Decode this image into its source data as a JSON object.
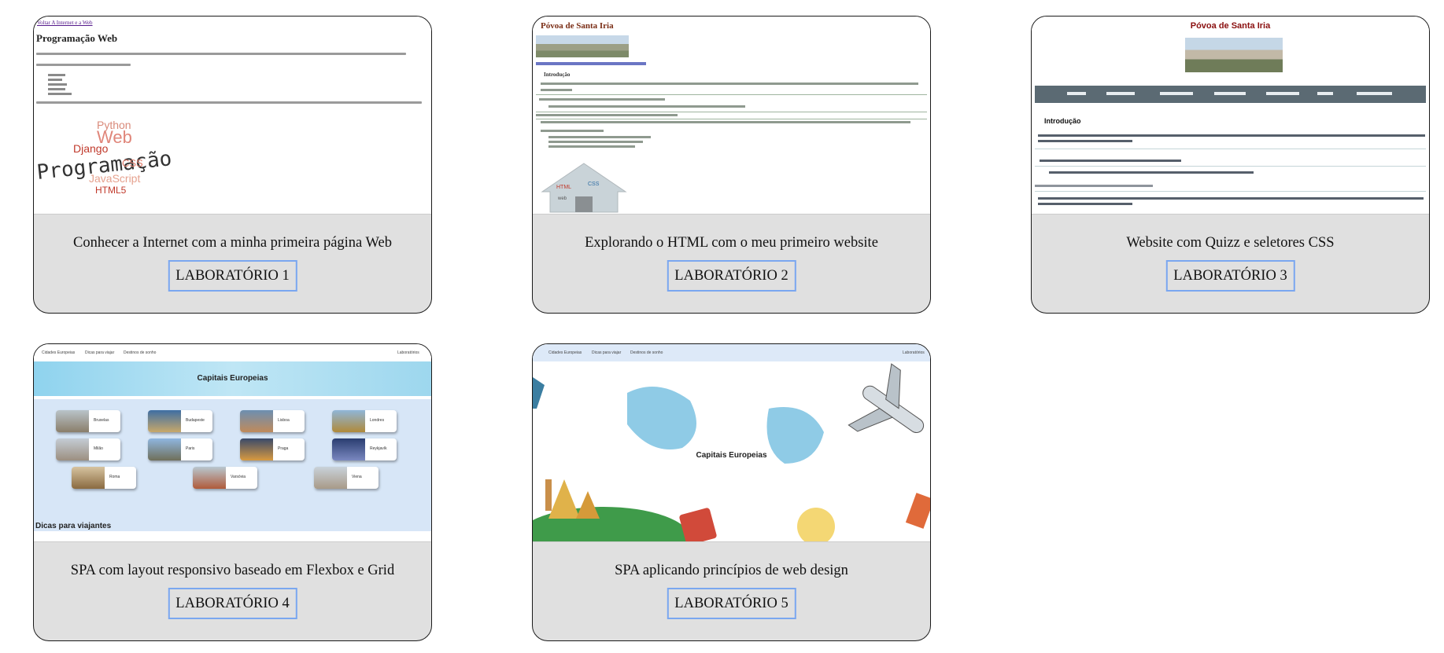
{
  "cards": [
    {
      "title": "Conhecer a Internet com a minha primeira página Web",
      "button": "LABORATÓRIO 1",
      "preview": {
        "breadcrumb": "Voltar A Internet e a Web",
        "heading": "Programação Web",
        "list": [
          "HTML",
          "CSS",
          "Python",
          "Django",
          "JavaScript"
        ],
        "wordcloud": [
          "Python",
          "Web",
          "Django",
          "Programação",
          "CSS",
          "JavaScript",
          "HTML5"
        ]
      }
    },
    {
      "title": "Explorando o HTML com o meu primeiro website",
      "button": "LABORATÓRIO 2",
      "preview": {
        "heading": "Póvoa de Santa Iria",
        "subheading": "Introdução"
      }
    },
    {
      "title": "Website com Quizz e seletores CSS",
      "button": "LABORATÓRIO 3",
      "preview": {
        "heading": "Póvoa de Santa Iria",
        "subheading": "Introdução",
        "nav": [
          "Home",
          "Introdução",
          "Localização",
          "Multimédia",
          "Informações",
          "Quiz",
          "HTML5 e CSS"
        ]
      }
    },
    {
      "title": "SPA com layout responsivo baseado em Flexbox e Grid",
      "button": "LABORATÓRIO 4",
      "preview": {
        "nav": [
          "Cidades Europeias",
          "Dicas para viajar",
          "Destinos de sonho"
        ],
        "nav_right": "Laboratórios",
        "banner": "Capitais Europeias",
        "cities": [
          "Bruxelas",
          "Budapeste",
          "Lisboa",
          "Londres",
          "Milão",
          "Paris",
          "Praga",
          "Reykjavík",
          "Roma",
          "Varsóvia",
          "Viena"
        ],
        "section": "Dicas para viajantes"
      }
    },
    {
      "title": "SPA aplicando princípios de web design",
      "button": "LABORATÓRIO 5",
      "preview": {
        "nav": [
          "Cidades Europeias",
          "Dicas para viajar",
          "Destinos de sonho"
        ],
        "nav_right": "Laboratórios",
        "hero": "Capitais Europeias"
      }
    }
  ],
  "colors": {
    "card_bg": "#e0e0e0",
    "button_border": "#7aa7f0",
    "card_border": "#1a1a1a"
  }
}
